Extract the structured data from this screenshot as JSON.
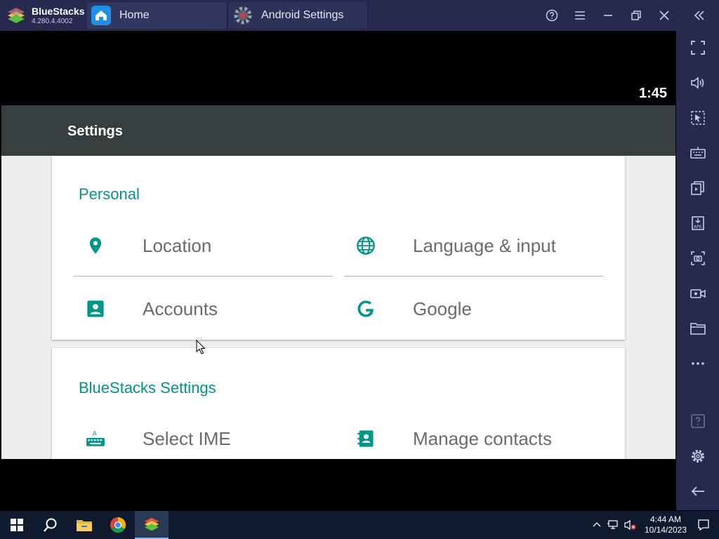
{
  "window": {
    "brand_name": "BlueStacks",
    "brand_version": "4.280.4.4002",
    "tabs": [
      {
        "label": "Home",
        "icon": "home-icon"
      },
      {
        "label": "Android Settings",
        "icon": "gear-icon"
      }
    ],
    "controls": [
      "help-icon",
      "menu-icon",
      "minimize-icon",
      "restore-icon",
      "close-icon",
      "collapse-sidebar-icon"
    ]
  },
  "android": {
    "clock": "1:45",
    "appbar_title": "Settings",
    "sections": [
      {
        "header": "Personal",
        "items": [
          {
            "label": "Location",
            "icon": "location-pin-icon"
          },
          {
            "label": "Language & input",
            "icon": "globe-icon"
          },
          {
            "label": "Accounts",
            "icon": "account-box-icon"
          },
          {
            "label": "Google",
            "icon": "google-g-icon"
          }
        ]
      },
      {
        "header": "BlueStacks Settings",
        "items": [
          {
            "label": "Select IME",
            "icon": "keyboard-icon"
          },
          {
            "label": "Manage contacts",
            "icon": "contacts-book-icon"
          }
        ]
      }
    ],
    "accent_color": "#009688"
  },
  "sidebar": {
    "icons": [
      "fullscreen-icon",
      "volume-icon",
      "pointer-select-icon",
      "keyboard-controls-icon",
      "multi-instance-icon",
      "install-apk-icon",
      "screenshot-icon",
      "record-video-icon",
      "folder-icon",
      "more-icon",
      "help-icon",
      "settings-icon",
      "back-icon"
    ]
  },
  "taskbar": {
    "time": "4:44 AM",
    "date": "10/14/2023"
  }
}
